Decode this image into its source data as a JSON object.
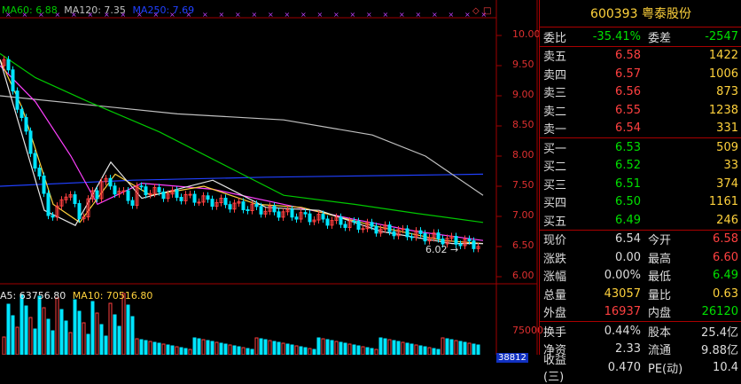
{
  "colors": {
    "up": "#ff4040",
    "down": "#00e5ff",
    "ma5": "#e6e6e6",
    "ma10": "#ffd23c",
    "ma20": "#ff40ff",
    "ma60": "#00c800",
    "ma120": "#c0c0c0",
    "ma250": "#2040ff",
    "grid": "#a00000",
    "yellow": "#ffd23c",
    "green": "#00e000"
  },
  "legend": {
    "ma60": "MA60: 6.88",
    "ma120": "MA120: 7.35",
    "ma250": "MA250: 7.69",
    "vol_ma5": "A5: 63756.80",
    "vol_ma10": "MA10: 70516.80"
  },
  "price_axis": {
    "ticks": [
      "10.00",
      "9.50",
      "9.00",
      "8.50",
      "8.00",
      "7.50",
      "7.00",
      "6.50",
      "6.00"
    ],
    "vol_tick": "75000",
    "vol_value": "38812"
  },
  "low_marker": "6.02",
  "quote": {
    "title": "600393 粤泰股份",
    "wei_bi_label": "委比",
    "wei_bi": "-35.41%",
    "wei_cha_label": "委差",
    "wei_cha": "-2547",
    "sells": [
      {
        "label": "卖五",
        "price": "6.58",
        "qty": "1422"
      },
      {
        "label": "卖四",
        "price": "6.57",
        "qty": "1006"
      },
      {
        "label": "卖三",
        "price": "6.56",
        "qty": "873"
      },
      {
        "label": "卖二",
        "price": "6.55",
        "qty": "1238"
      },
      {
        "label": "卖一",
        "price": "6.54",
        "qty": "331"
      }
    ],
    "buys": [
      {
        "label": "买一",
        "price": "6.53",
        "qty": "509"
      },
      {
        "label": "买二",
        "price": "6.52",
        "qty": "33"
      },
      {
        "label": "买三",
        "price": "6.51",
        "qty": "374"
      },
      {
        "label": "买四",
        "price": "6.50",
        "qty": "1161"
      },
      {
        "label": "买五",
        "price": "6.49",
        "qty": "246"
      }
    ],
    "stats": [
      {
        "l1": "现价",
        "v1": "6.54",
        "c1": "white",
        "l2": "今开",
        "v2": "6.58",
        "c2": "red"
      },
      {
        "l1": "涨跌",
        "v1": "0.00",
        "c1": "white",
        "l2": "最高",
        "v2": "6.60",
        "c2": "red"
      },
      {
        "l1": "涨幅",
        "v1": "0.00%",
        "c1": "white",
        "l2": "最低",
        "v2": "6.49",
        "c2": "green"
      },
      {
        "l1": "总量",
        "v1": "43057",
        "c1": "yellow",
        "l2": "量比",
        "v2": "0.63",
        "c2": "yellow"
      },
      {
        "l1": "外盘",
        "v1": "16937",
        "c1": "red",
        "l2": "内盘",
        "v2": "26120",
        "c2": "green"
      }
    ],
    "stats2": [
      {
        "l1": "换手",
        "v1": "0.44%",
        "l2": "股本",
        "v2": "25.4亿"
      },
      {
        "l1": "净资",
        "v1": "2.33",
        "l2": "流通",
        "v2": "9.88亿"
      },
      {
        "l1": "收益(三)",
        "v1": "0.470",
        "l2": "PE(动)",
        "v2": "10.4"
      }
    ]
  }
}
